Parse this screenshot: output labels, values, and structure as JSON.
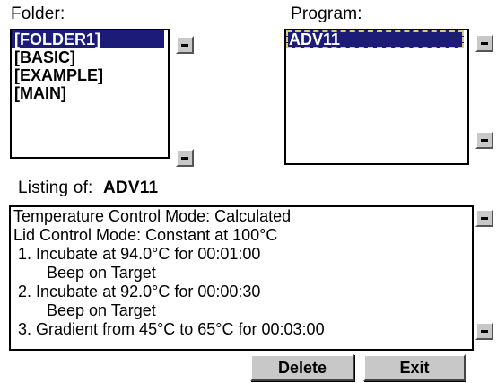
{
  "folder": {
    "label": "Folder:",
    "items": [
      {
        "text": "[FOLDER1]",
        "selected": true
      },
      {
        "text": "[BASIC]",
        "selected": false
      },
      {
        "text": "[EXAMPLE]",
        "selected": false
      },
      {
        "text": "[MAIN]",
        "selected": false
      }
    ]
  },
  "program": {
    "label": "Program:",
    "items": [
      {
        "text": "ADV11",
        "selected": true
      }
    ]
  },
  "listing": {
    "label": "Listing of:",
    "program_name": "ADV11",
    "lines": [
      {
        "text": "Temperature Control Mode: Calculated",
        "indent": 0
      },
      {
        "text": "Lid Control Mode: Constant at 100°C",
        "indent": 0
      },
      {
        "text": "1. Incubate at 94.0°C for 00:01:00",
        "indent": 1
      },
      {
        "text": "Beep on Target",
        "indent": 2
      },
      {
        "text": "2. Incubate at 92.0°C for 00:00:30",
        "indent": 1
      },
      {
        "text": "Beep on Target",
        "indent": 2
      },
      {
        "text": "3. Gradient from 45°C to 65°C for 00:03:00",
        "indent": 1
      }
    ]
  },
  "buttons": {
    "delete_label": "Delete",
    "exit_label": "Exit"
  },
  "colors": {
    "selection_bg": "#1c1c78",
    "button_face": "#c8c8c8",
    "focus_outline": "#d7d070"
  },
  "icons": {
    "scroll_up": "scroll-up-icon",
    "scroll_down": "scroll-down-icon"
  }
}
